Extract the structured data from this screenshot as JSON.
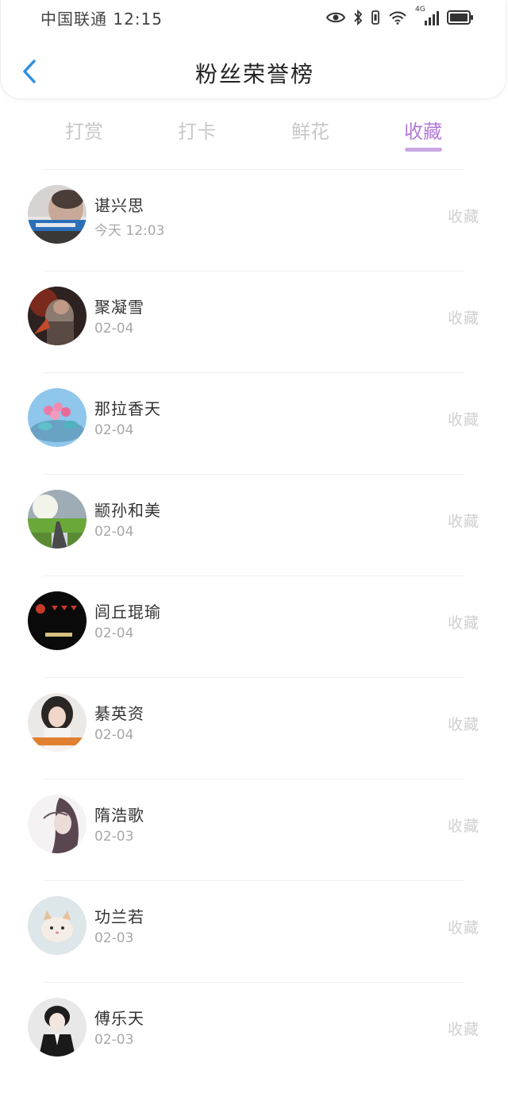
{
  "status_bar": {
    "carrier_time": "中国联通 12:15",
    "network": "4G"
  },
  "header": {
    "title": "粉丝荣誉榜"
  },
  "tabs": [
    {
      "label": "打赏",
      "active": false
    },
    {
      "label": "打卡",
      "active": false
    },
    {
      "label": "鲜花",
      "active": false
    },
    {
      "label": "收藏",
      "active": true
    }
  ],
  "colors": {
    "accent": "#b27ad6",
    "back_arrow": "#2f8fe0",
    "inactive_tab": "#c8c8c8"
  },
  "fans": [
    {
      "name": "谌兴思",
      "time": "今天 12:03",
      "action": "收藏",
      "avatar": "boy-photo"
    },
    {
      "name": "聚凝雪",
      "time": "02-04",
      "action": "收藏",
      "avatar": "warrior-art"
    },
    {
      "name": "那拉香天",
      "time": "02-04",
      "action": "收藏",
      "avatar": "flower-cake"
    },
    {
      "name": "颛孙和美",
      "time": "02-04",
      "action": "收藏",
      "avatar": "road-landscape"
    },
    {
      "name": "闾丘琨瑜",
      "time": "02-04",
      "action": "收藏",
      "avatar": "dark-hearts"
    },
    {
      "name": "綦英资",
      "time": "02-04",
      "action": "收藏",
      "avatar": "girl-photo"
    },
    {
      "name": "隋浩歌",
      "time": "02-03",
      "action": "收藏",
      "avatar": "anime-sketch"
    },
    {
      "name": "功兰若",
      "time": "02-03",
      "action": "收藏",
      "avatar": "kitten"
    },
    {
      "name": "傅乐天",
      "time": "02-03",
      "action": "收藏",
      "avatar": "suited-man"
    }
  ]
}
